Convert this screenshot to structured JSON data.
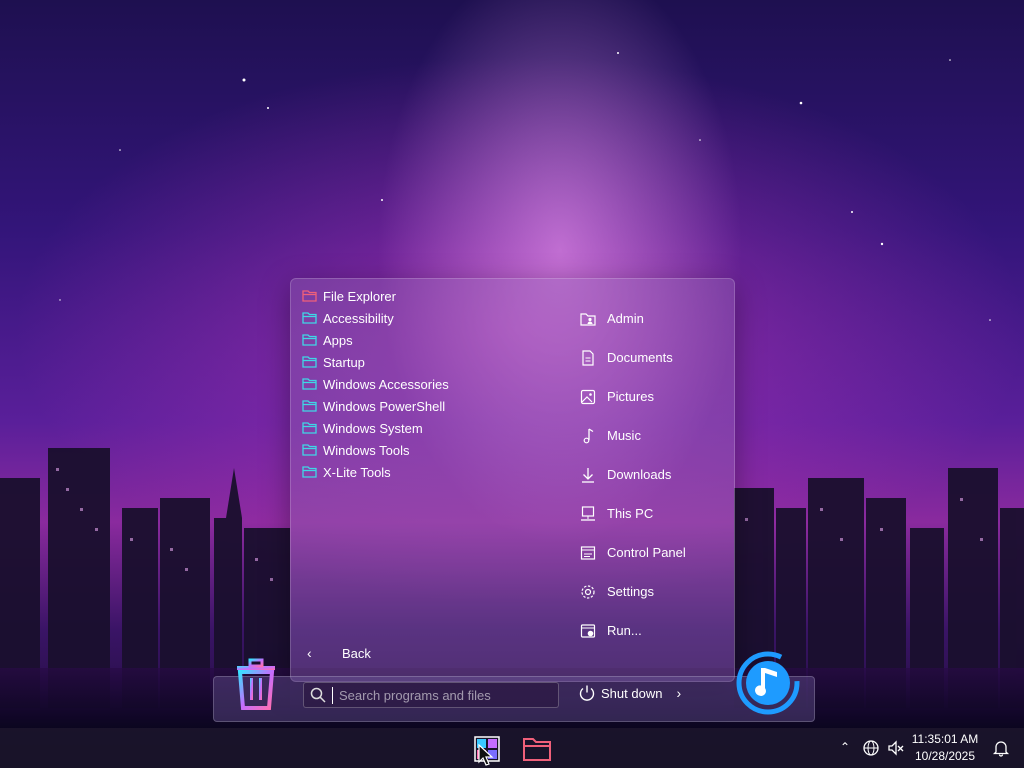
{
  "start_menu": {
    "programs": [
      {
        "label": "File Explorer",
        "icon": "folder-red-icon"
      },
      {
        "label": "Accessibility",
        "icon": "folder-icon"
      },
      {
        "label": "Apps",
        "icon": "folder-icon"
      },
      {
        "label": "Startup",
        "icon": "folder-icon"
      },
      {
        "label": "Windows Accessories",
        "icon": "folder-icon"
      },
      {
        "label": "Windows PowerShell",
        "icon": "folder-icon"
      },
      {
        "label": "Windows System",
        "icon": "folder-icon"
      },
      {
        "label": "Windows Tools",
        "icon": "folder-icon"
      },
      {
        "label": "X-Lite Tools",
        "icon": "folder-icon"
      }
    ],
    "places": [
      {
        "label": "Admin",
        "icon": "user-folder-icon"
      },
      {
        "label": "Documents",
        "icon": "document-icon"
      },
      {
        "label": "Pictures",
        "icon": "picture-icon"
      },
      {
        "label": "Music",
        "icon": "music-note-icon"
      },
      {
        "label": "Downloads",
        "icon": "download-icon"
      },
      {
        "label": "This PC",
        "icon": "computer-icon"
      },
      {
        "label": "Control Panel",
        "icon": "control-panel-icon"
      },
      {
        "label": "Settings",
        "icon": "gear-icon"
      },
      {
        "label": "Run...",
        "icon": "run-icon"
      }
    ],
    "back_label": "Back",
    "search_placeholder": "Search programs and files",
    "shutdown_label": "Shut down"
  },
  "taskbar": {
    "time": "11:35:01 AM",
    "date": "10/28/2025"
  },
  "colors": {
    "folder_cyan": "#3fd7e6",
    "folder_red": "#f0607a",
    "accent_blue": "#1e9bff"
  }
}
